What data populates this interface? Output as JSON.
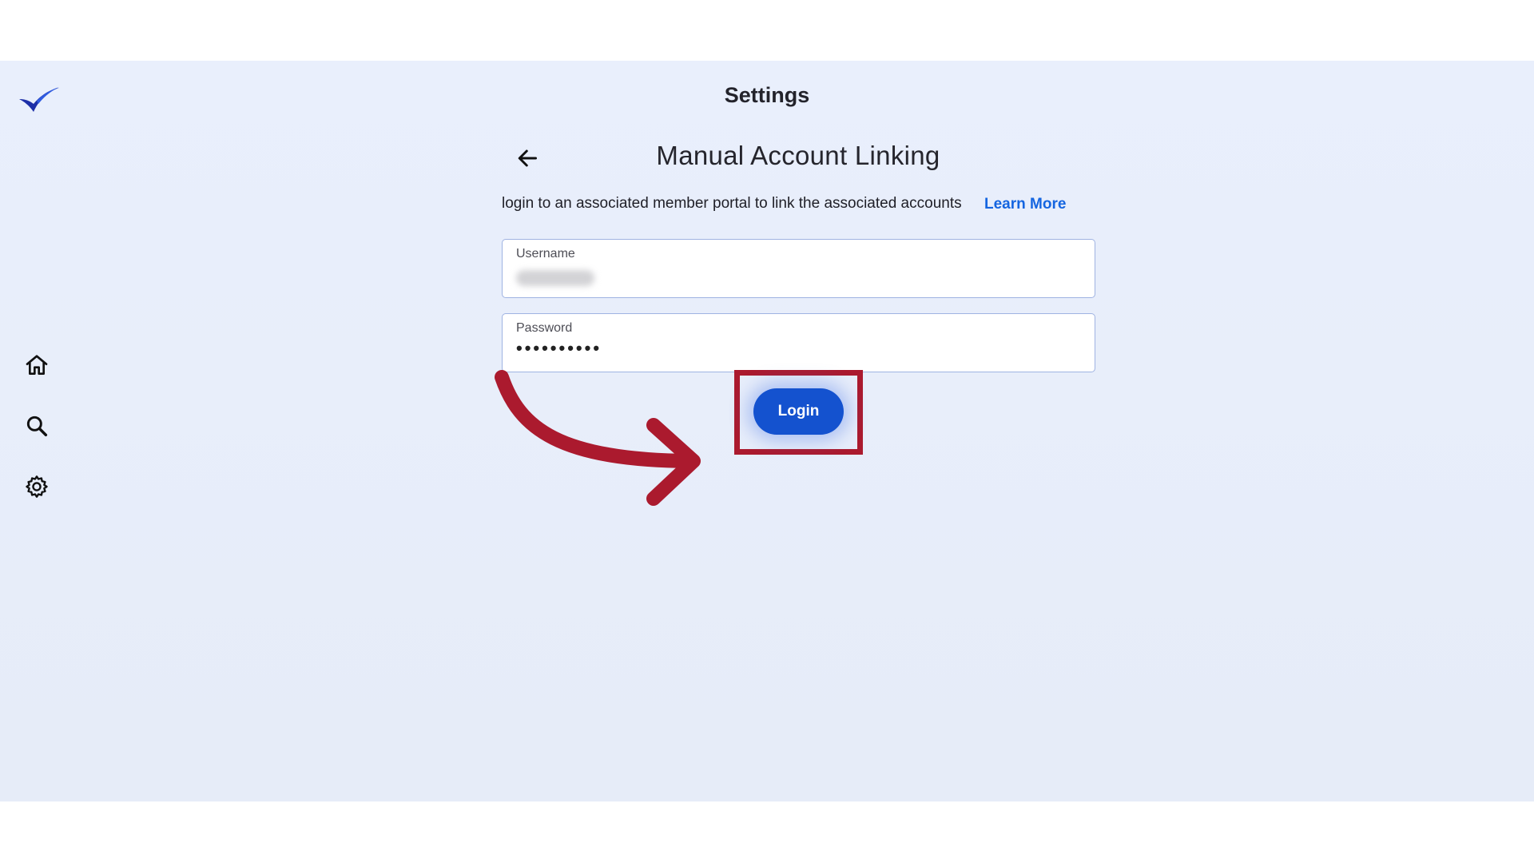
{
  "header": {
    "title": "Settings"
  },
  "section": {
    "title": "Manual Account Linking",
    "description": "login to an associated member portal to link the associated accounts",
    "learn_more": "Learn More"
  },
  "form": {
    "username": {
      "label": "Username"
    },
    "password": {
      "label": "Password",
      "value": "••••••••••"
    },
    "login_label": "Login"
  },
  "sidebar": {
    "items": [
      {
        "icon": "home-icon"
      },
      {
        "icon": "search-icon"
      },
      {
        "icon": "gear-icon"
      }
    ]
  },
  "colors": {
    "accent": "#1452cf",
    "link": "#1565e0",
    "annotation": "#ab1a2e",
    "background": "#e9effc"
  }
}
